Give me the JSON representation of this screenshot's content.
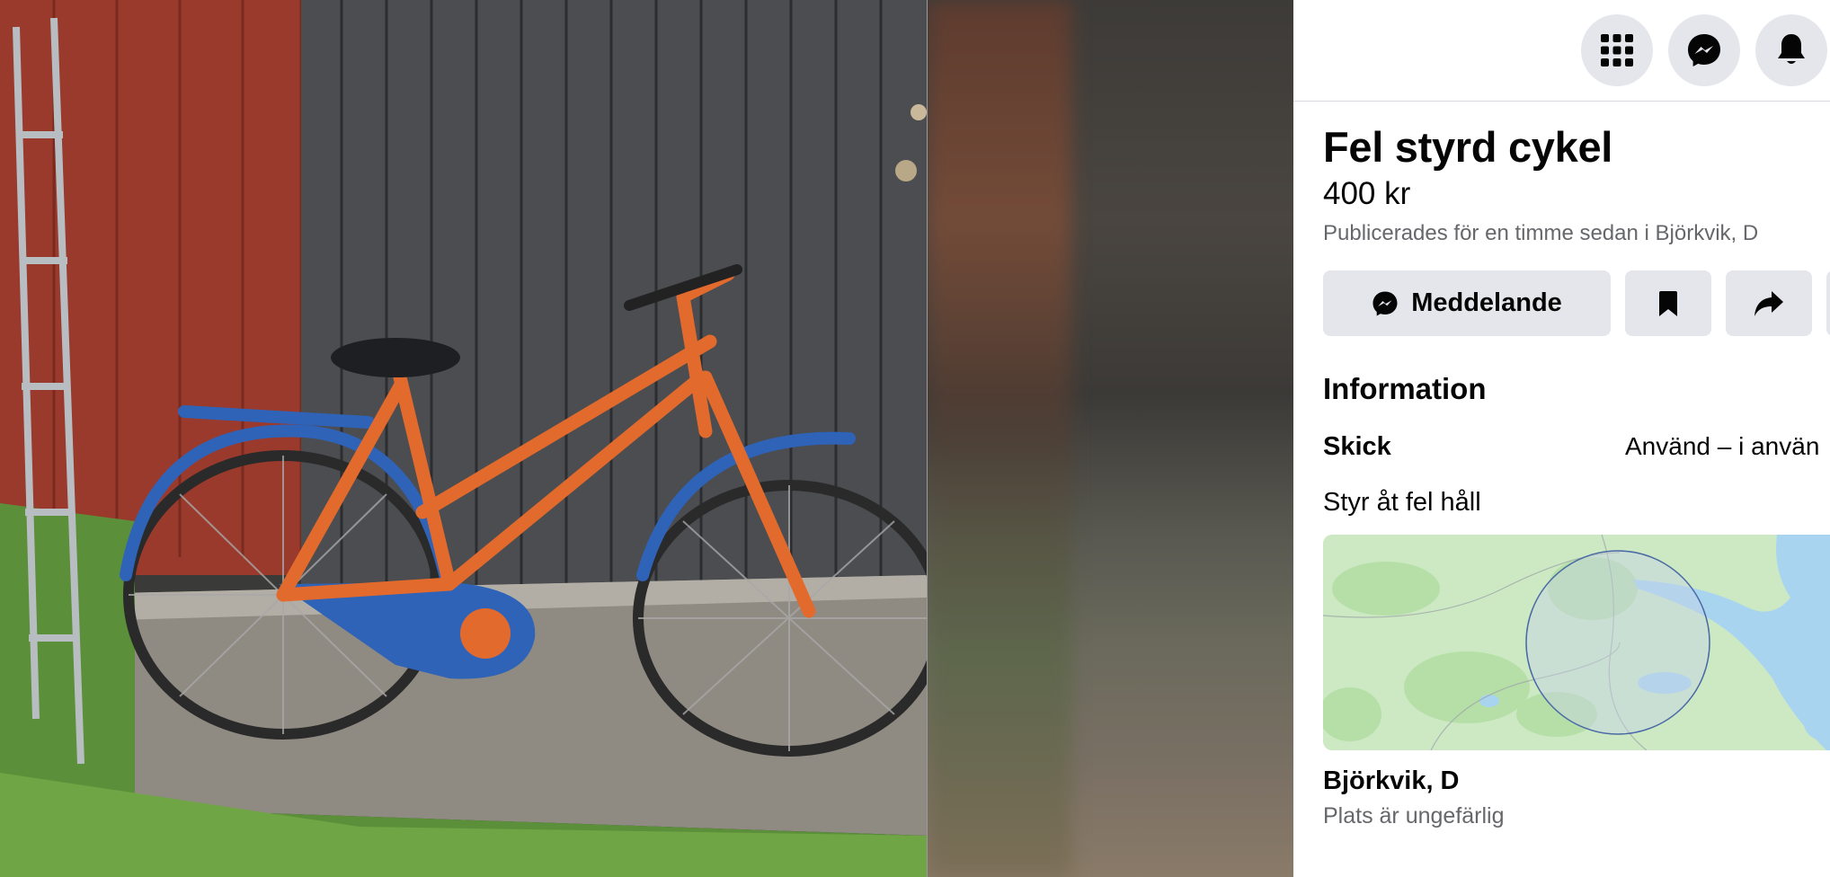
{
  "header": {
    "menu_icon": "grid-menu-icon",
    "messenger_icon": "messenger-icon",
    "notifications_icon": "bell-icon"
  },
  "listing": {
    "title": "Fel styrd cykel",
    "price": "400 kr",
    "posted": "Publicerades för en timme sedan i Björkvik, D"
  },
  "actions": {
    "message_label": "Meddelande",
    "save_icon": "bookmark-icon",
    "share_icon": "share-icon"
  },
  "information": {
    "heading": "Information",
    "condition_label": "Skick",
    "condition_value": "Använd – i använ",
    "description": "Styr åt fel håll"
  },
  "location": {
    "name": "Björkvik, D",
    "note": "Plats är ungefärlig"
  },
  "colors": {
    "button_bg": "#e4e6eb",
    "secondary_text": "#65676b",
    "primary_text": "#050505",
    "map_land": "#cde9c4",
    "map_water": "#a8d4f0"
  }
}
